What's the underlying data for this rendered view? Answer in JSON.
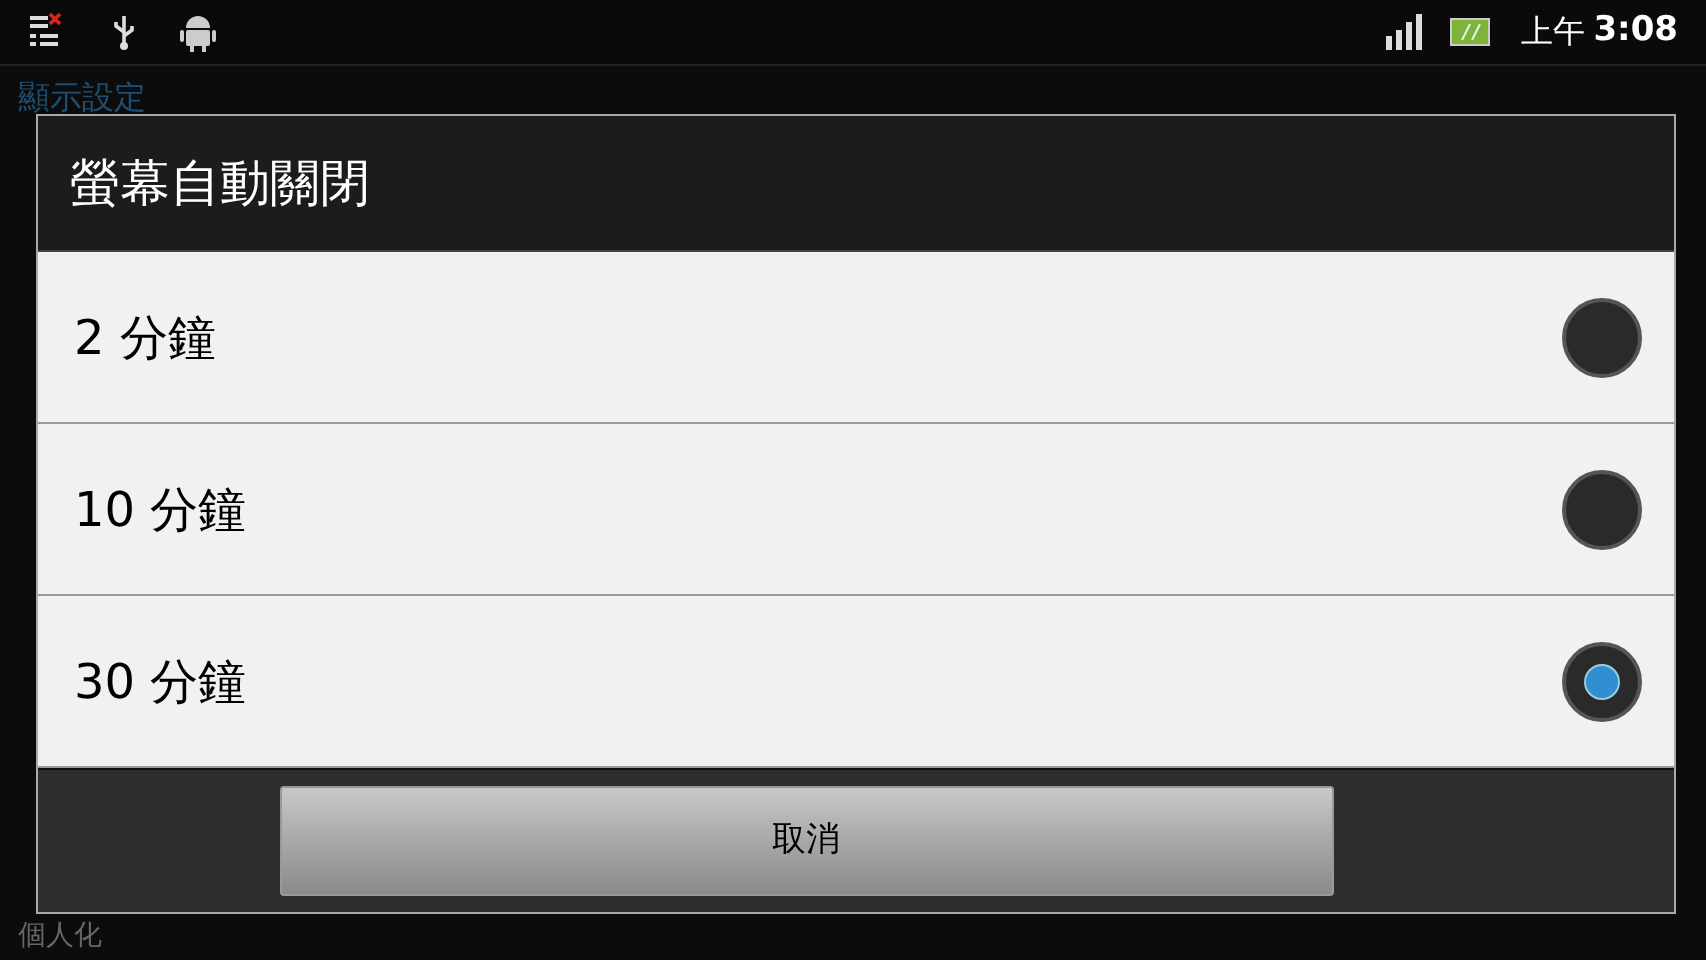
{
  "status_bar": {
    "time_period": "上午",
    "time": "3:08"
  },
  "background": {
    "header": "顯示設定",
    "footer_item": "個人化"
  },
  "dialog": {
    "title": "螢幕自動關閉",
    "options": [
      {
        "label": "2 分鐘",
        "selected": false
      },
      {
        "label": "10 分鐘",
        "selected": false
      },
      {
        "label": "30 分鐘",
        "selected": true
      }
    ],
    "cancel_button": "取消"
  }
}
